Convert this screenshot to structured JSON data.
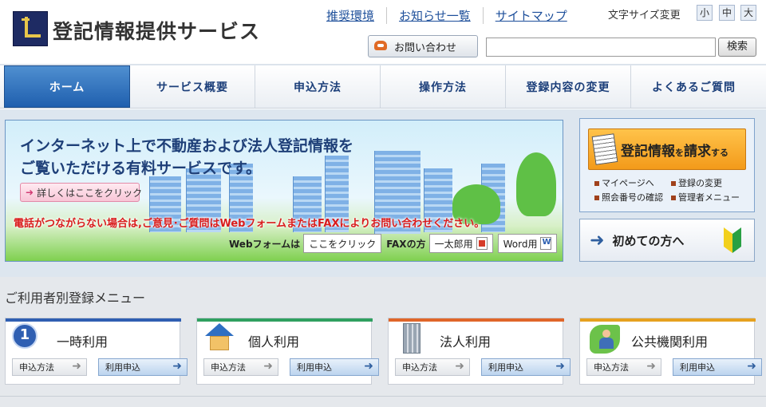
{
  "header": {
    "site_title": "登記情報提供サービス",
    "top_links": [
      "推奨環境",
      "お知らせ一覧",
      "サイトマップ"
    ],
    "font_size_label": "文字サイズ変更",
    "font_size_options": [
      "小",
      "中",
      "大"
    ],
    "contact_label": "お問い合わせ",
    "search_value": "",
    "search_button": "検索"
  },
  "nav": {
    "items": [
      "ホーム",
      "サービス概要",
      "申込方法",
      "操作方法",
      "登録内容の変更",
      "よくあるご質問"
    ],
    "active_index": 0
  },
  "hero": {
    "line1": "インターネット上で不動産および法人登記情報を",
    "line2": "ご覧いただける有料サービスです。",
    "detail_button": "詳しくはここをクリック",
    "notice": "電話がつながらない場合は,ご意見･ご質問はWebフォームまたはFAXによりお問い合わせください。",
    "webform_label": "Webフォームは",
    "webform_button": "ここをクリック",
    "fax_label": "FAXの方",
    "fax_button_1": "一太郎用",
    "fax_button_2": "Word用"
  },
  "request_panel": {
    "main_part1": "登記情報",
    "main_small1": "を",
    "main_part2": "請求",
    "main_small2": "する",
    "links": [
      "マイページへ",
      "登録の変更",
      "照会番号の確認",
      "管理者メニュー"
    ]
  },
  "first_time": {
    "label": "初めての方へ"
  },
  "user_menu": {
    "section_title": "ご利用者別登録メニュー",
    "cards": [
      {
        "title": "一時利用",
        "btn1": "申込方法",
        "btn2": "利用申込",
        "color": "#2f5fb2",
        "icon_text": "1"
      },
      {
        "title": "個人利用",
        "btn1": "申込方法",
        "btn2": "利用申込",
        "color": "#2fa060"
      },
      {
        "title": "法人利用",
        "btn1": "申込方法",
        "btn2": "利用申込",
        "color": "#e0662a"
      },
      {
        "title": "公共機関利用",
        "btn1": "申込方法",
        "btn2": "利用申込",
        "color": "#e6a11f"
      }
    ]
  }
}
